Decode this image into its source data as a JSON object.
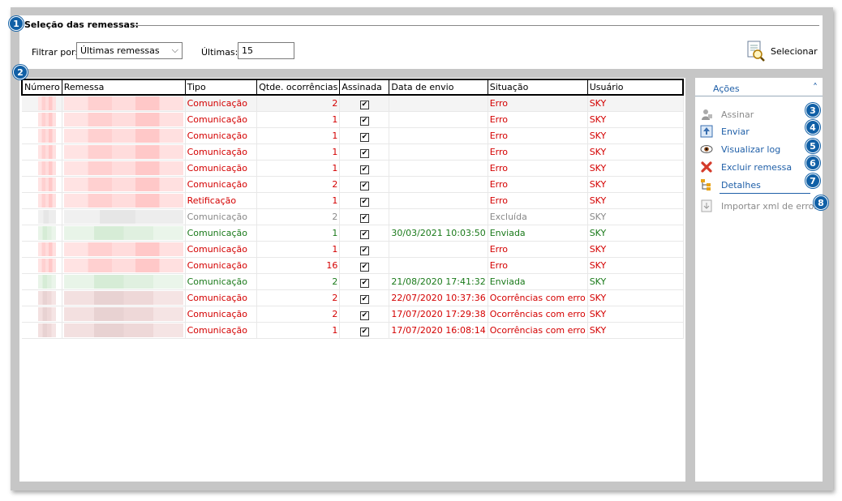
{
  "selection": {
    "title": "Seleção das remessas:",
    "filter_label": "Filtrar por:",
    "filter_value": "Últimas remessas",
    "ultimas_label": "Últimas:",
    "ultimas_value": "15",
    "select_button": "Selecionar"
  },
  "table": {
    "columns": [
      "Número",
      "Remessa",
      "Tipo",
      "Qtde. ocorrências",
      "Assinada",
      "Data de envio",
      "Situação",
      "Usuário"
    ],
    "rows": [
      {
        "tipo": "Comunicação",
        "qtde": "2",
        "data": "",
        "situacao": "Erro",
        "usuario": "SKY",
        "status": "red"
      },
      {
        "tipo": "Comunicação",
        "qtde": "1",
        "data": "",
        "situacao": "Erro",
        "usuario": "SKY",
        "status": "red"
      },
      {
        "tipo": "Comunicação",
        "qtde": "1",
        "data": "",
        "situacao": "Erro",
        "usuario": "SKY",
        "status": "red"
      },
      {
        "tipo": "Comunicação",
        "qtde": "1",
        "data": "",
        "situacao": "Erro",
        "usuario": "SKY",
        "status": "red"
      },
      {
        "tipo": "Comunicação",
        "qtde": "1",
        "data": "",
        "situacao": "Erro",
        "usuario": "SKY",
        "status": "red"
      },
      {
        "tipo": "Comunicação",
        "qtde": "2",
        "data": "",
        "situacao": "Erro",
        "usuario": "SKY",
        "status": "red"
      },
      {
        "tipo": "Retificação",
        "qtde": "1",
        "data": "",
        "situacao": "Erro",
        "usuario": "SKY",
        "status": "red"
      },
      {
        "tipo": "Comunicação",
        "qtde": "2",
        "data": "",
        "situacao": "Excluída",
        "usuario": "SKY",
        "status": "gray"
      },
      {
        "tipo": "Comunicação",
        "qtde": "1",
        "data": "30/03/2021 10:03:50",
        "situacao": "Enviada",
        "usuario": "SKY",
        "status": "green"
      },
      {
        "tipo": "Comunicação",
        "qtde": "1",
        "data": "",
        "situacao": "Erro",
        "usuario": "SKY",
        "status": "red"
      },
      {
        "tipo": "Comunicação",
        "qtde": "16",
        "data": "",
        "situacao": "Erro",
        "usuario": "SKY",
        "status": "red"
      },
      {
        "tipo": "Comunicação",
        "qtde": "2",
        "data": "21/08/2020 17:41:32",
        "situacao": "Enviada",
        "usuario": "SKY",
        "status": "green"
      },
      {
        "tipo": "Comunicação",
        "qtde": "2",
        "data": "22/07/2020 10:37:36",
        "situacao": "Ocorrências com erro",
        "usuario": "SKY",
        "status": "red"
      },
      {
        "tipo": "Comunicação",
        "qtde": "2",
        "data": "17/07/2020 17:29:38",
        "situacao": "Ocorrências com erro",
        "usuario": "SKY",
        "status": "red"
      },
      {
        "tipo": "Comunicação",
        "qtde": "1",
        "data": "17/07/2020 16:08:14",
        "situacao": "Ocorrências com erro",
        "usuario": "SKY",
        "status": "red"
      }
    ]
  },
  "actions": {
    "title": "Ações",
    "items": [
      {
        "label": "Assinar",
        "icon": "sign-icon",
        "enabled": false
      },
      {
        "label": "Enviar",
        "icon": "upload-icon",
        "enabled": true
      },
      {
        "label": "Visualizar log",
        "icon": "eye-icon",
        "enabled": true
      },
      {
        "label": "Excluir remessa",
        "icon": "delete-icon",
        "enabled": true
      },
      {
        "label": "Detalhes",
        "icon": "tree-icon",
        "enabled": true
      },
      {
        "label": "Importar xml de erros",
        "icon": "import-icon",
        "enabled": false
      }
    ]
  },
  "badges": [
    "1",
    "2",
    "3",
    "4",
    "5",
    "6",
    "7",
    "8"
  ],
  "colors": {
    "error": "#d40000",
    "sent": "#1a7a1a",
    "deleted": "#888888",
    "accent": "#1160a6"
  }
}
